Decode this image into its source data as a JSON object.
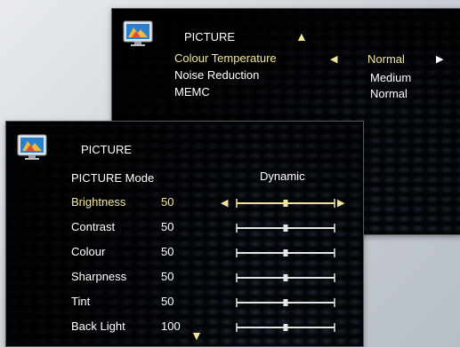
{
  "top_menu": {
    "title": "PICTURE",
    "up_arrow": "▲",
    "items": [
      {
        "label": "Colour Temperature",
        "value": "Normal",
        "selected": true
      },
      {
        "label": "Noise Reduction",
        "value": "Medium",
        "selected": false
      },
      {
        "label": "MEMC",
        "value": "Normal",
        "selected": false
      }
    ],
    "left_arrow": "◀",
    "right_arrow": "▶"
  },
  "bottom_menu": {
    "title": "PICTURE",
    "mode_label": "PICTURE Mode",
    "mode_value": "Dynamic",
    "down_arrow": "▼",
    "left_arrow": "◀",
    "right_arrow": "▶",
    "items": [
      {
        "label": "Brightness",
        "value": "50",
        "selected": true,
        "level": 0.5
      },
      {
        "label": "Contrast",
        "value": "50",
        "selected": false,
        "level": 0.5
      },
      {
        "label": "Colour",
        "value": "50",
        "selected": false,
        "level": 0.5
      },
      {
        "label": "Sharpness",
        "value": "50",
        "selected": false,
        "level": 0.5
      },
      {
        "label": "Tint",
        "value": "50",
        "selected": false,
        "level": 0.5
      },
      {
        "label": "Back Light",
        "value": "100",
        "selected": false,
        "level": 0.5
      }
    ]
  },
  "colors": {
    "selected": "#f4e49a",
    "text": "#ffffff",
    "slider_track": "#e6e6e6"
  },
  "icons": [
    "tv-monitor-icon",
    "up-arrow-icon",
    "down-arrow-icon",
    "left-arrow-icon",
    "right-arrow-icon"
  ]
}
